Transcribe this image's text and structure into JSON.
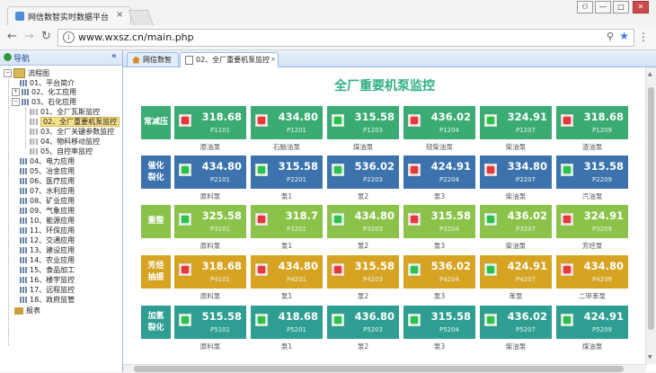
{
  "browser": {
    "tab_title": "网信数智实时数据平台",
    "tab_close": "×",
    "url": "www.wxsz.cn/main.php",
    "win_user": "⚇",
    "win_min": "—",
    "win_max": "□",
    "win_close": "✕"
  },
  "sidebar": {
    "header": "导航",
    "collapse": "«",
    "root": "流程图",
    "report": "报表",
    "items": [
      {
        "label": "01、平台简介"
      },
      {
        "label": "02、化工应用"
      },
      {
        "label": "03、石化应用"
      },
      {
        "label": "01、全厂瓦斯监控"
      },
      {
        "label": "02、全厂重要机泵监控"
      },
      {
        "label": "03、全厂关键参数监控"
      },
      {
        "label": "04、物料移动监控"
      },
      {
        "label": "05、自控率监控"
      },
      {
        "label": "04、电力应用"
      },
      {
        "label": "05、冶金应用"
      },
      {
        "label": "06、医疗应用"
      },
      {
        "label": "07、水利应用"
      },
      {
        "label": "08、矿业应用"
      },
      {
        "label": "09、气象应用"
      },
      {
        "label": "10、能源应用"
      },
      {
        "label": "11、环保应用"
      },
      {
        "label": "12、交通应用"
      },
      {
        "label": "13、建设应用"
      },
      {
        "label": "14、农业应用"
      },
      {
        "label": "15、食品加工"
      },
      {
        "label": "16、楼宇监控"
      },
      {
        "label": "17、远程监控"
      },
      {
        "label": "18、政府监管"
      }
    ]
  },
  "main_tabs": [
    {
      "label": "网信数智"
    },
    {
      "label": "02、全厂重要机泵监控",
      "close": "×"
    }
  ],
  "page_title": "全厂重要机泵监控",
  "colors": {
    "title": "#2fae85",
    "lamp_red": "#e23a3a",
    "lamp_green": "#2fbf4f"
  },
  "rows": [
    {
      "label": "常减压",
      "color": "#3aab73",
      "cards": [
        {
          "value": "318.68",
          "code": "P1101",
          "name": "原油泵",
          "lamp": "red"
        },
        {
          "value": "434.80",
          "code": "P1201",
          "name": "石脑油泵",
          "lamp": "red"
        },
        {
          "value": "315.58",
          "code": "P1203",
          "name": "煤油泵",
          "lamp": "green"
        },
        {
          "value": "436.02",
          "code": "P1204",
          "name": "轻柴油泵",
          "lamp": "red"
        },
        {
          "value": "324.91",
          "code": "P1207",
          "name": "柴油泵",
          "lamp": "green"
        },
        {
          "value": "318.68",
          "code": "P1209",
          "name": "渣油泵",
          "lamp": "red"
        }
      ]
    },
    {
      "label": "催化\n裂化",
      "color": "#3d73ad",
      "cards": [
        {
          "value": "434.80",
          "code": "P2101",
          "name": "原料泵",
          "lamp": "green"
        },
        {
          "value": "315.58",
          "code": "P2201",
          "name": "泵1",
          "lamp": "green"
        },
        {
          "value": "536.02",
          "code": "P2203",
          "name": "泵2",
          "lamp": "green"
        },
        {
          "value": "424.91",
          "code": "P2204",
          "name": "泵3",
          "lamp": "red"
        },
        {
          "value": "334.80",
          "code": "P2207",
          "name": "柴油泵",
          "lamp": "red"
        },
        {
          "value": "315.58",
          "code": "P2209",
          "name": "汽油泵",
          "lamp": "green"
        }
      ]
    },
    {
      "label": "重整",
      "color": "#8bc34a",
      "cards": [
        {
          "value": "325.58",
          "code": "P3101",
          "name": "原料泵",
          "lamp": "green"
        },
        {
          "value": "318.7",
          "code": "P3201",
          "name": "泵1",
          "lamp": "red"
        },
        {
          "value": "434.80",
          "code": "P3203",
          "name": "泵2",
          "lamp": "green"
        },
        {
          "value": "315.58",
          "code": "P3204",
          "name": "泵3",
          "lamp": "red"
        },
        {
          "value": "436.02",
          "code": "P3207",
          "name": "柴油泵",
          "lamp": "green"
        },
        {
          "value": "324.91",
          "code": "P3209",
          "name": "芳烃泵",
          "lamp": "red"
        }
      ]
    },
    {
      "label": "芳烃\n抽提",
      "color": "#d6a422",
      "cards": [
        {
          "value": "318.68",
          "code": "P4101",
          "name": "原料泵",
          "lamp": "red"
        },
        {
          "value": "434.80",
          "code": "P4201",
          "name": "泵1",
          "lamp": "red"
        },
        {
          "value": "315.58",
          "code": "P4203",
          "name": "泵2",
          "lamp": "red"
        },
        {
          "value": "536.02",
          "code": "P4204",
          "name": "泵3",
          "lamp": "green"
        },
        {
          "value": "424.91",
          "code": "P4207",
          "name": "苯泵",
          "lamp": "green"
        },
        {
          "value": "434.80",
          "code": "P4209",
          "name": "二甲苯泵",
          "lamp": "red"
        }
      ]
    },
    {
      "label": "加氢\n裂化",
      "color": "#2e9e93",
      "cards": [
        {
          "value": "515.58",
          "code": "P5101",
          "name": "原料泵",
          "lamp": "green"
        },
        {
          "value": "418.68",
          "code": "P5201",
          "name": "泵1",
          "lamp": "green"
        },
        {
          "value": "436.80",
          "code": "P5203",
          "name": "泵2",
          "lamp": "green"
        },
        {
          "value": "315.58",
          "code": "P5204",
          "name": "泵3",
          "lamp": "green"
        },
        {
          "value": "436.02",
          "code": "P5207",
          "name": "柴油泵",
          "lamp": "green"
        },
        {
          "value": "424.91",
          "code": "P5209",
          "name": "煤油泵",
          "lamp": "green"
        }
      ]
    }
  ]
}
